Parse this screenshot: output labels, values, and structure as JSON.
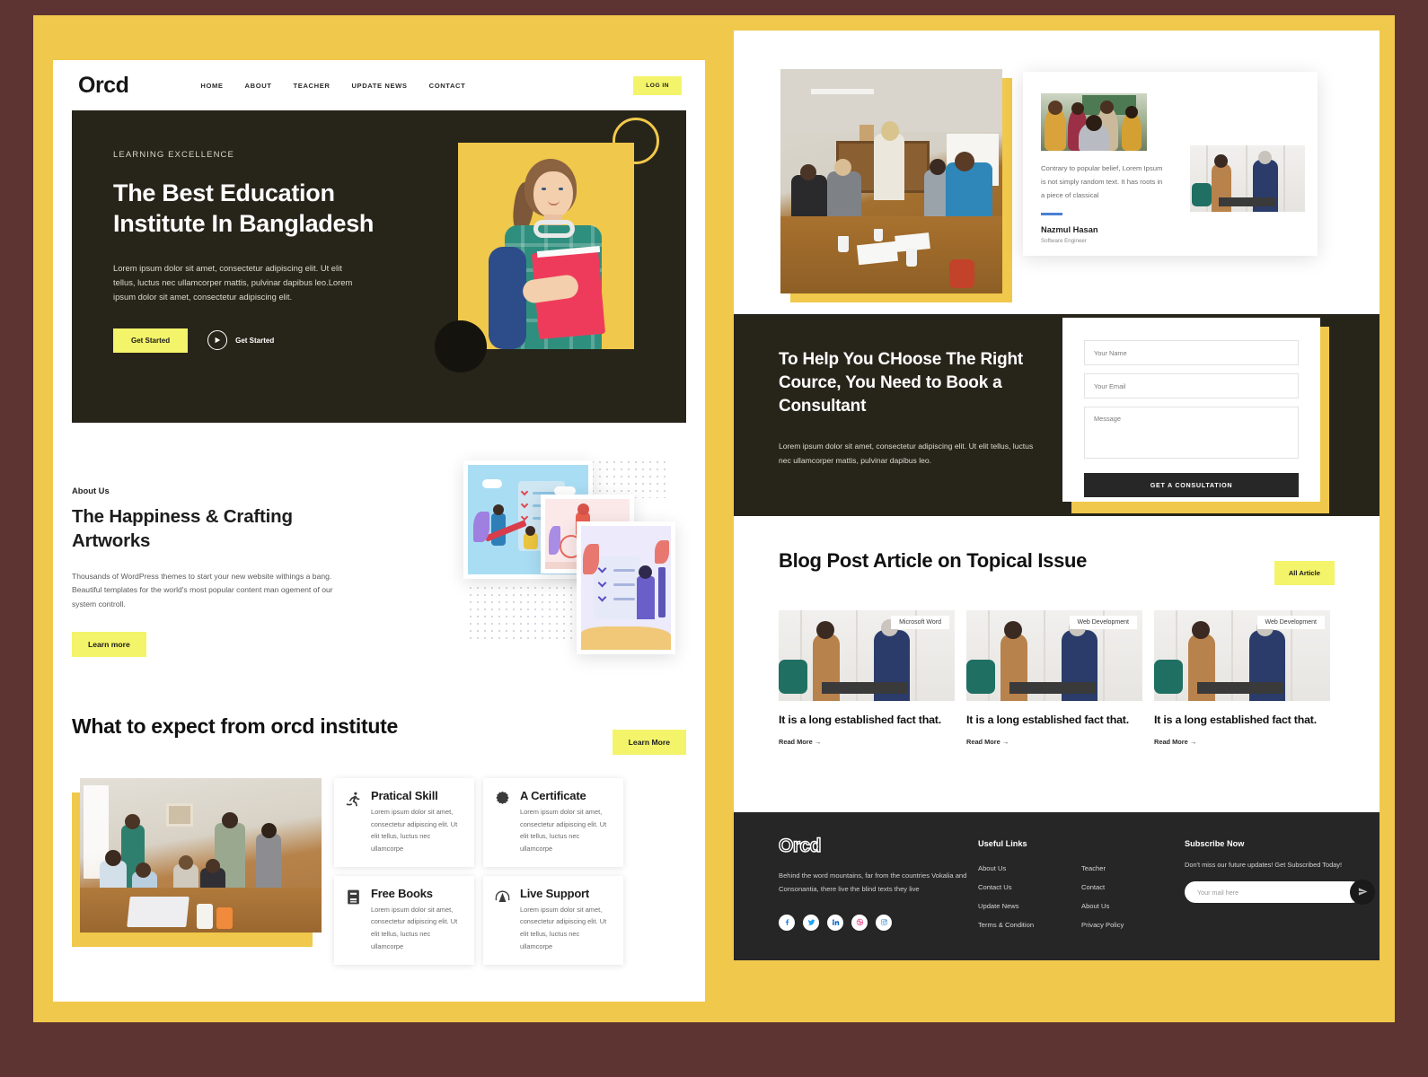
{
  "theme": {
    "yellow": "#f0c84b",
    "accent_yellow": "#f4f46a",
    "dark": "#27241a",
    "footer_dark": "#262626",
    "frame_border": "#5d3432",
    "testimonial_rule": "#4a7fd4"
  },
  "header": {
    "logo": "Orcd",
    "nav": [
      {
        "label": "HOME"
      },
      {
        "label": "ABOUT"
      },
      {
        "label": "TEACHER"
      },
      {
        "label": "UPDATE NEWS"
      },
      {
        "label": "CONTACT"
      }
    ],
    "login_label": "LOG IN"
  },
  "hero": {
    "eyebrow": "LEARNING EXCELLENCE",
    "title": "The Best Education Institute In Bangladesh",
    "body": "Lorem ipsum dolor sit amet, consectetur adipiscing elit. Ut elit tellus, luctus nec ullamcorper mattis, pulvinar dapibus leo.Lorem ipsum dolor sit amet, consectetur adipiscing elit.",
    "primary_cta": "Get Started",
    "secondary_cta": "Get Started"
  },
  "about": {
    "eyebrow": "About Us",
    "title": "The Happiness & Crafting Artworks",
    "body": "Thousands of WordPress themes to start your new website withings a bang. Beautiful templates for the world's most popular content man ogement of our system controll.",
    "cta": "Learn more"
  },
  "expect": {
    "title": "What to expect from orcd institute",
    "cta": "Learn More",
    "features": [
      {
        "icon": "skier-icon",
        "title": "Pratical Skill",
        "desc": "Lorem ipsum dolor sit amet, consectetur adipiscing elit. Ut elit tellus, luctus nec ullamcorpe"
      },
      {
        "icon": "certificate-badge-icon",
        "title": "A Certificate",
        "desc": "Lorem ipsum dolor sit amet, consectetur adipiscing elit. Ut elit tellus, luctus nec ullamcorpe"
      },
      {
        "icon": "book-icon",
        "title": "Free Books",
        "desc": "Lorem ipsum dolor sit amet, consectetur adipiscing elit. Ut elit tellus, luctus nec ullamcorpe"
      },
      {
        "icon": "headset-support-icon",
        "title": "Live Support",
        "desc": "Lorem ipsum dolor sit amet, consectetur adipiscing elit. Ut elit tellus, luctus nec ullamcorpe"
      }
    ]
  },
  "testimonial": {
    "quote": "Contrary to popular belief, Lorem Ipsum is not simply random text. It has roots in a piece of classical",
    "name": "Nazmul Hasan",
    "role": "Software Engineer"
  },
  "consult": {
    "title": "To Help You CHoose The Right Cource, You Need to Book a Consultant",
    "body": "Lorem ipsum dolor sit amet, consectetur adipiscing elit. Ut elit tellus, luctus nec ullamcorper mattis, pulvinar dapibus leo.",
    "form": {
      "name_placeholder": "Your Name",
      "email_placeholder": "Your Email",
      "message_placeholder": "Message",
      "submit_label": "GET A CONSULTATION"
    }
  },
  "blog": {
    "title": "Blog Post Article on Topical Issue",
    "cta": "All Article",
    "posts": [
      {
        "tag": "Microsoft Word",
        "title": "It is a long established fact that.",
        "read_more": "Read More →"
      },
      {
        "tag": "Web Development",
        "title": "It is a long established fact that.",
        "read_more": "Read More →"
      },
      {
        "tag": "Web Development",
        "title": "It is a long established fact that.",
        "read_more": "Read More →"
      }
    ]
  },
  "footer": {
    "logo": "Orcd",
    "desc": "Behind the word mountains, far from the countries Vokalia and Consonantia, there live the blind texts they live",
    "socials": [
      {
        "name": "facebook-icon"
      },
      {
        "name": "twitter-icon"
      },
      {
        "name": "linkedin-icon"
      },
      {
        "name": "dribbble-icon"
      },
      {
        "name": "instagram-icon"
      }
    ],
    "links_heading": "Useful Links",
    "links_col1": [
      {
        "label": "About Us"
      },
      {
        "label": "Contact Us"
      },
      {
        "label": "Update News"
      },
      {
        "label": "Terms & Condition"
      }
    ],
    "links_col2": [
      {
        "label": "Teacher"
      },
      {
        "label": "Contact"
      },
      {
        "label": "About Us"
      },
      {
        "label": "Privacy Policy"
      }
    ],
    "subscribe_heading": "Subscribe Now",
    "subscribe_text": "Don't miss our future updates! Get Subscribed Today!",
    "subscribe_placeholder": "Your mail here",
    "subscribe_button": "send-icon"
  }
}
